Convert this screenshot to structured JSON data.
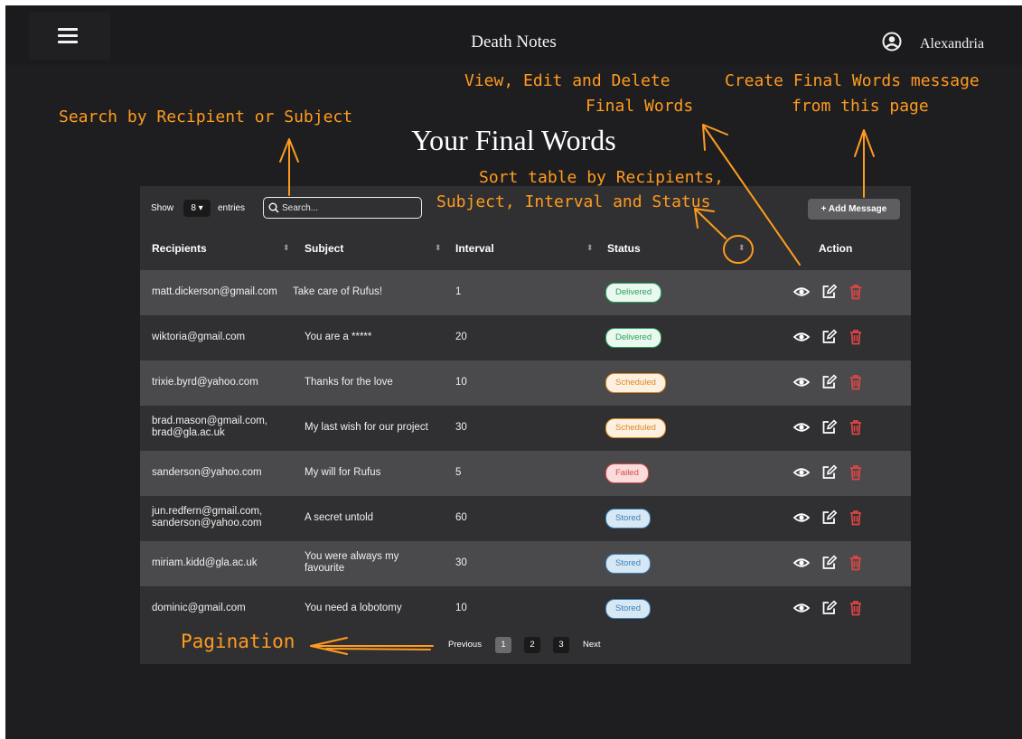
{
  "header": {
    "app_title": "Death Notes",
    "user_name": "Alexandria",
    "menu_icon": "hamburger-menu-icon",
    "user_icon": "user-circle-icon"
  },
  "page_title": "Your Final Words",
  "controls": {
    "show_label": "Show",
    "entries_value": "8 ▾",
    "entries_label": "entries",
    "search_placeholder": "Search...",
    "add_button_label": "+ Add Message"
  },
  "table": {
    "columns": [
      "Recipients",
      "Subject",
      "Interval",
      "Status",
      "Action"
    ],
    "rows": [
      {
        "recipients": "matt.dickerson@gmail.com",
        "subject": "Take care of Rufus!",
        "interval": "1",
        "status": "Delivered"
      },
      {
        "recipients": "wiktoria@gmail.com",
        "subject": "You are a *****",
        "interval": "20",
        "status": "Delivered"
      },
      {
        "recipients": "trixie.byrd@yahoo.com",
        "subject": "Thanks for the love",
        "interval": "10",
        "status": "Scheduled"
      },
      {
        "recipients": "brad.mason@gmail.com, brad@gla.ac.uk",
        "subject": "My last wish for our project",
        "interval": "30",
        "status": "Scheduled"
      },
      {
        "recipients": "sanderson@yahoo.com",
        "subject": "My will for Rufus",
        "interval": "5",
        "status": "Failed"
      },
      {
        "recipients": "jun.redfern@gmail.com, sanderson@yahoo.com",
        "subject": "A secret untold",
        "interval": "60",
        "status": "Stored"
      },
      {
        "recipients": "miriam.kidd@gla.ac.uk",
        "subject": "You were always my favourite",
        "interval": "30",
        "status": "Stored"
      },
      {
        "recipients": "dominic@gmail.com",
        "subject": "You need a lobotomy",
        "interval": "10",
        "status": "Stored"
      }
    ],
    "action_icons": [
      "eye-icon",
      "edit-icon",
      "trash-icon"
    ]
  },
  "pagination": {
    "previous_label": "Previous",
    "pages": [
      "1",
      "2",
      "3"
    ],
    "current_page": "1",
    "next_label": "Next"
  },
  "annotations": {
    "view_edit_delete": "View, Edit and Delete Final Words",
    "create_message": "Create Final Words message from this page",
    "search_hint": "Search by Recipient or Subject",
    "sort_hint": "Sort table by Recipients, Subject, Interval and Status",
    "pagination_hint": "Pagination"
  },
  "colors": {
    "background": "#1e1e20",
    "annotation": "#ff9b1f",
    "delivered": "#27a35a",
    "scheduled": "#d98a22",
    "failed": "#d64a4a",
    "stored": "#3d7fb8",
    "delete_icon": "#e04545"
  }
}
